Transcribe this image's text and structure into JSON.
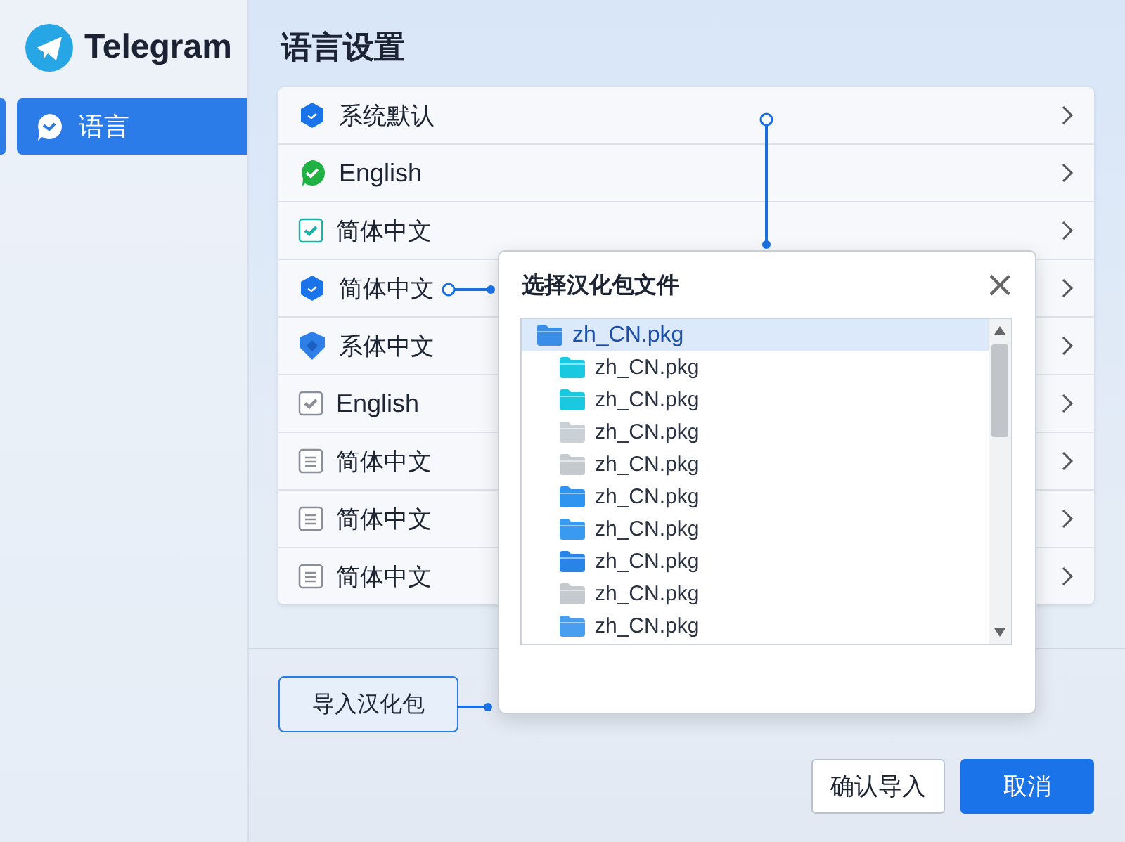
{
  "sidebar": {
    "app_name": "Telegram",
    "items": [
      {
        "label": "语言",
        "selected": true
      }
    ]
  },
  "page_title": "语言设置",
  "languages": [
    {
      "label": "系统默认",
      "kind": "hexagon",
      "color": "#1a73e8"
    },
    {
      "label": "English",
      "kind": "bubble",
      "color": "#1fb141"
    },
    {
      "label": "简体中文",
      "kind": "checkbox",
      "color": "#19b3a6"
    },
    {
      "label": "简体中文",
      "kind": "hexagon",
      "color": "#1a73e8"
    },
    {
      "label": "系体中文",
      "kind": "shield",
      "color": "#2f7fe8"
    },
    {
      "label": "English",
      "kind": "checkbox",
      "color": "#8a8f99"
    },
    {
      "label": "简体中文",
      "kind": "document",
      "color": "#8a8f99"
    },
    {
      "label": "简体中文",
      "kind": "document",
      "color": "#8a8f99"
    },
    {
      "label": "简体中文",
      "kind": "document",
      "color": "#8a8f99"
    }
  ],
  "import_button": "导入汉化包",
  "dialog": {
    "title": "选择汉化包文件",
    "close": "×",
    "files": [
      {
        "name": "zh_CN.pkg",
        "color": "#3a8ee6",
        "selected": true,
        "children": [
          {
            "name": "zh_CN.pkg",
            "color": "#18c9e0",
            "selected": false
          },
          {
            "name": "zh_CN.pkg",
            "color": "#18c9e0",
            "selected": false
          },
          {
            "name": "zh_CN.pkg",
            "color": "#c9d0d6",
            "selected": false
          },
          {
            "name": "zh_CN.pkg",
            "color": "#c4c9cd",
            "selected": false
          },
          {
            "name": "zh_CN.pkg",
            "color": "#2f93f0",
            "selected": false
          },
          {
            "name": "zh_CN.pkg",
            "color": "#3a9af0",
            "selected": false
          },
          {
            "name": "zh_CN.pkg",
            "color": "#2a84e8",
            "selected": false
          },
          {
            "name": "zh_CN.pkg",
            "color": "#c4c9cd",
            "selected": false
          },
          {
            "name": "zh_CN.pkg",
            "color": "#4a9ef0",
            "selected": false
          }
        ]
      }
    ]
  },
  "buttons": [
    {
      "label": "确认导入",
      "kind": "secondary"
    },
    {
      "label": "取消",
      "kind": "primary"
    }
  ]
}
